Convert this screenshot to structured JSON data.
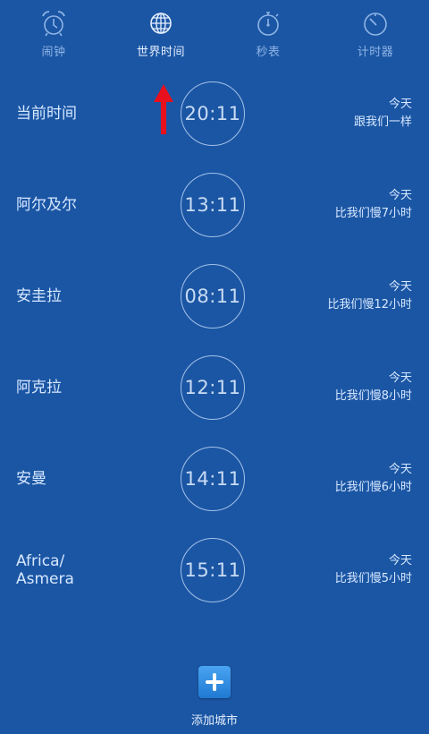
{
  "tabs": [
    {
      "label": "闹钟",
      "icon": "alarm-clock-icon",
      "active": false
    },
    {
      "label": "世界时间",
      "icon": "globe-icon",
      "active": true
    },
    {
      "label": "秒表",
      "icon": "stopwatch-icon",
      "active": false
    },
    {
      "label": "计时器",
      "icon": "timer-icon",
      "active": false
    }
  ],
  "cities": [
    {
      "name": "当前时间",
      "time": "20:11",
      "day": "今天",
      "difference": "跟我们一样"
    },
    {
      "name": "阿尔及尔",
      "time": "13:11",
      "day": "今天",
      "difference": "比我们慢7小时"
    },
    {
      "name": "安圭拉",
      "time": "08:11",
      "day": "今天",
      "difference": "比我们慢12小时"
    },
    {
      "name": "阿克拉",
      "time": "12:11",
      "day": "今天",
      "difference": "比我们慢8小时"
    },
    {
      "name": "安曼",
      "time": "14:11",
      "day": "今天",
      "difference": "比我们慢6小时"
    },
    {
      "name": "Africa/\nAsmera",
      "time": "15:11",
      "day": "今天",
      "difference": "比我们慢5小时"
    }
  ],
  "add_city": {
    "label": "添加城市",
    "icon": "plus-icon"
  },
  "colors": {
    "background": "#1b56a4",
    "accent": "#2c8de6",
    "annotation": "#e8101c"
  }
}
